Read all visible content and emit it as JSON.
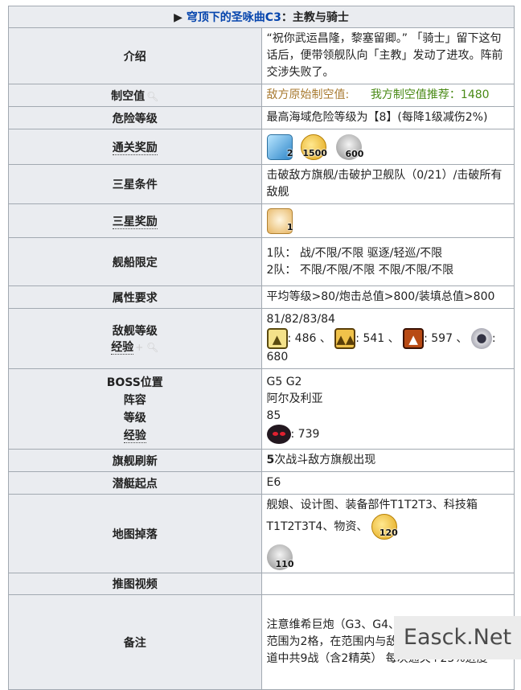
{
  "header": {
    "arrow": "▶",
    "title_link": "穹顶下的圣咏曲C3",
    "title_rest": "：主教与骑士"
  },
  "rows": {
    "intro": {
      "label": "介绍",
      "text": "“祝你武运昌隆，黎塞留卿。” 「骑士」留下这句话后，便带领舰队向「主教」发动了进攻。阵前交涉失败了。"
    },
    "air": {
      "label": "制空值",
      "enemy": "敌方原始制空值:",
      "recommend": "我方制空值推荐：1480"
    },
    "danger": {
      "label": "危险等级",
      "text": "最高海域危险等级为【8】(每降1级减伤2%)"
    },
    "reward": {
      "label": "通关奖励",
      "items": [
        {
          "icon": "cube-icon",
          "count": "2"
        },
        {
          "icon": "coin-icon",
          "count": "1500"
        },
        {
          "icon": "oil-icon",
          "count": "600"
        }
      ]
    },
    "stars": {
      "label": "三星条件",
      "text": "击破敌方旗舰/击破护卫舰队（0/21）/击破所有敌舰"
    },
    "star_reward": {
      "label": "三星奖励",
      "item": {
        "icon": "cat-box-icon",
        "count": "1"
      }
    },
    "limit": {
      "label": "舰船限定",
      "line1": "1队： 战/不限/不限 驱逐/轻巡/不限",
      "line2": "2队： 不限/不限/不限 不限/不限/不限"
    },
    "attr": {
      "label": "属性要求",
      "text": "平均等级>80/炮击总值>800/装填总值>800"
    },
    "enemy": {
      "label1": "敌舰等级",
      "label2": "经验",
      "levels": "81/82/83/84",
      "exp": [
        {
          "icon": "small-fleet-icon",
          "value": ": 486 、"
        },
        {
          "icon": "medium-fleet-icon",
          "value": ": 541 、"
        },
        {
          "icon": "large-fleet-icon",
          "value": ": 597 、"
        },
        {
          "icon": "siren-icon",
          "value": ": 680"
        }
      ]
    },
    "boss": {
      "label1": "BOSS位置",
      "label2": "阵容",
      "label3": "等级",
      "label4": "经验",
      "pos": "G5 G2",
      "lineup": "阿尔及利亚",
      "level": "85",
      "exp": ": 739"
    },
    "flag": {
      "label": "旗舰刷新",
      "num": "5",
      "text": "次战斗敌方旗舰出现"
    },
    "sub": {
      "label": "潜艇起点",
      "text": "E6"
    },
    "drop": {
      "label": "地图掉落",
      "text": "舰娘、设计图、装备部件T1T2T3、科技箱T1T2T3T4、物资、",
      "coin": "120",
      "oil": "110"
    },
    "video": {
      "label": "推图视频",
      "text": ""
    },
    "note": {
      "label": "备注",
      "line1": "注意维希巨炮（G3、G4、H3、H4四点合并），范围为2格，在范围内与敌舰作战会被巨炮炮击",
      "line2": "道中共9战（含2精英） 每次通关+25%进度"
    }
  },
  "watermark": "Easck.Net"
}
